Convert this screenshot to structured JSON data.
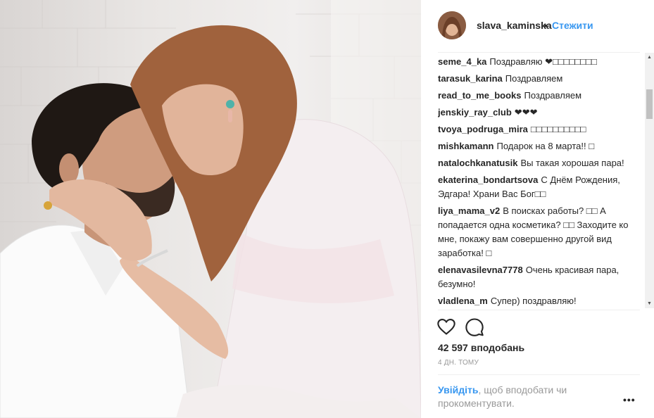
{
  "post": {
    "photo_alt": "",
    "username": "slava_kaminska",
    "separator": "•",
    "follow_label": "Стежити",
    "likes": "42 597 вподобань",
    "time": "4 ДН. ТОМУ",
    "login_link": "Увійдіть",
    "login_text": ", щоб вподобати чи прокоментувати.",
    "more_label": "•••"
  },
  "comments": [
    {
      "user": "seme_4_ka",
      "text": "Поздравляю ❤□□□□□□□□"
    },
    {
      "user": "tarasuk_karina",
      "text": "Поздравляем"
    },
    {
      "user": "read_to_me_books",
      "text": "Поздравляем"
    },
    {
      "user": "jenskiy_ray_club",
      "text": "❤❤❤"
    },
    {
      "user": "tvoya_podruga_mira",
      "text": "□□□□□□□□□□"
    },
    {
      "user": "mishkamann",
      "text": "Подарок на 8 марта!! □"
    },
    {
      "user": "natalochkanatusik",
      "text": "Вы такая хорошая пара!"
    },
    {
      "user": "ekaterina_bondartsova",
      "text": "С Днём Рождения, Эдгара! Храни Вас Бог□□"
    },
    {
      "user": "liya_mama_v2",
      "text": "В поисках работы? □□ А попадается одна косметика? □□ Заходите ко мне, покажу вам совершенно другой вид заработка! □"
    },
    {
      "user": "elenavasilevna7778",
      "text": "Очень красивая пара, безумно!"
    },
    {
      "user": "vladlena_m",
      "text": "Супер) поздравляю!"
    }
  ],
  "icons": {
    "like": "heart-outline-icon",
    "comment": "speech-bubble-icon"
  },
  "colors": {
    "link_blue": "#3897f0",
    "text": "#262626",
    "muted": "#999999"
  }
}
